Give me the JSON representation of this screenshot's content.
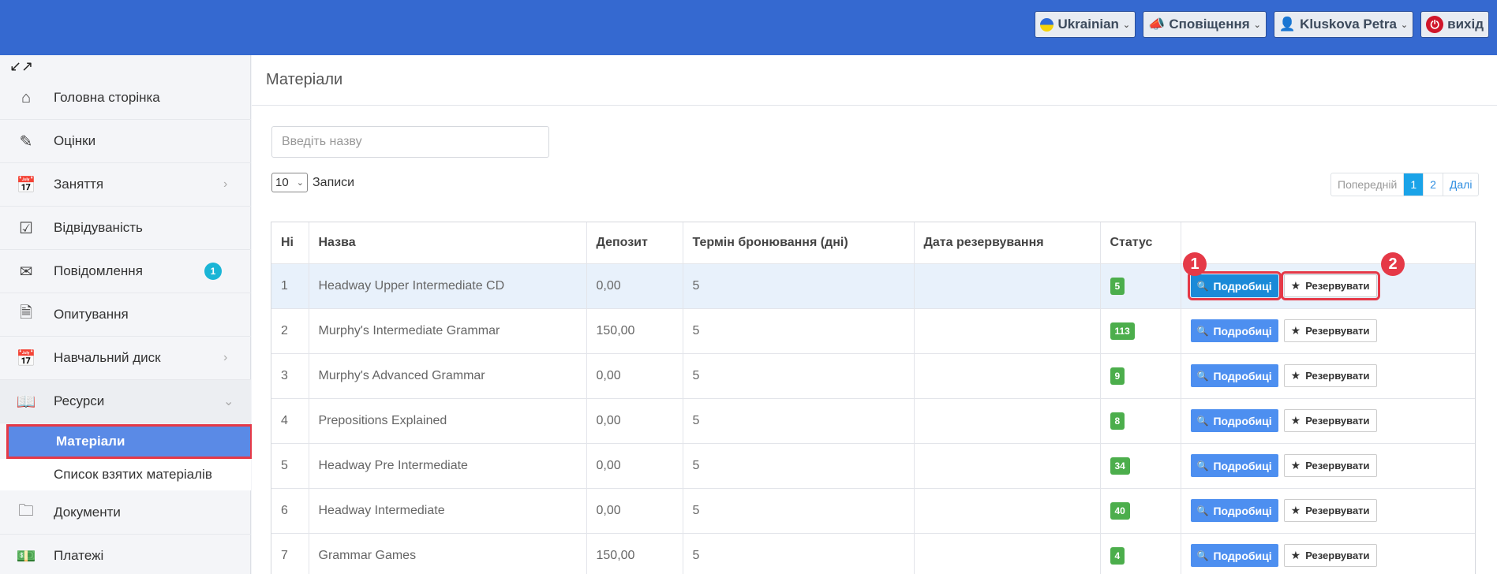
{
  "topbar": {
    "language": "Ukrainian",
    "notifications": "Сповіщення",
    "user": "Kluskova Petra",
    "logout": "вихід"
  },
  "sidebar": {
    "items": [
      {
        "label": "Головна сторінка",
        "icon": "home-icon"
      },
      {
        "label": "Оцінки",
        "icon": "grades-icon"
      },
      {
        "label": "Заняття",
        "icon": "calendar-icon"
      },
      {
        "label": "Відвідуваність",
        "icon": "checkbox-icon"
      },
      {
        "label": "Повідомлення",
        "icon": "envelope-icon",
        "badge": "1"
      },
      {
        "label": "Опитування",
        "icon": "survey-icon"
      },
      {
        "label": "Навчальний диск",
        "icon": "calendar-icon"
      },
      {
        "label": "Ресурси",
        "icon": "book-icon"
      },
      {
        "label": "Документи",
        "icon": "folder-icon"
      },
      {
        "label": "Платежі",
        "icon": "money-icon"
      }
    ],
    "subitems": [
      {
        "label": "Матеріали"
      },
      {
        "label": "Список взятих матеріалів"
      }
    ]
  },
  "page": {
    "title": "Матеріали",
    "search_placeholder": "Введіть назву",
    "per_page": "10",
    "records_label": "Записи"
  },
  "pager": {
    "prev": "Попередній",
    "pages": [
      "1",
      "2"
    ],
    "next": "Далі"
  },
  "table": {
    "headers": [
      "Ні",
      "Назва",
      "Депозит",
      "Термін бронювання (дні)",
      "Дата резервування",
      "Статус",
      ""
    ],
    "rows": [
      {
        "n": "1",
        "name": "Headway Upper Intermediate CD",
        "deposit": "0,00",
        "term": "5",
        "date": "",
        "status": "5"
      },
      {
        "n": "2",
        "name": "Murphy's Intermediate Grammar",
        "deposit": "150,00",
        "term": "5",
        "date": "",
        "status": "113"
      },
      {
        "n": "3",
        "name": "Murphy's Advanced Grammar",
        "deposit": "0,00",
        "term": "5",
        "date": "",
        "status": "9"
      },
      {
        "n": "4",
        "name": "Prepositions Explained",
        "deposit": "0,00",
        "term": "5",
        "date": "",
        "status": "8"
      },
      {
        "n": "5",
        "name": "Headway Pre Intermediate",
        "deposit": "0,00",
        "term": "5",
        "date": "",
        "status": "34"
      },
      {
        "n": "6",
        "name": "Headway Intermediate",
        "deposit": "0,00",
        "term": "5",
        "date": "",
        "status": "40"
      },
      {
        "n": "7",
        "name": "Grammar Games",
        "deposit": "150,00",
        "term": "5",
        "date": "",
        "status": "4"
      }
    ],
    "details_label": "Подробиці",
    "reserve_label": "Резервувати"
  },
  "markers": [
    "1",
    "2"
  ]
}
